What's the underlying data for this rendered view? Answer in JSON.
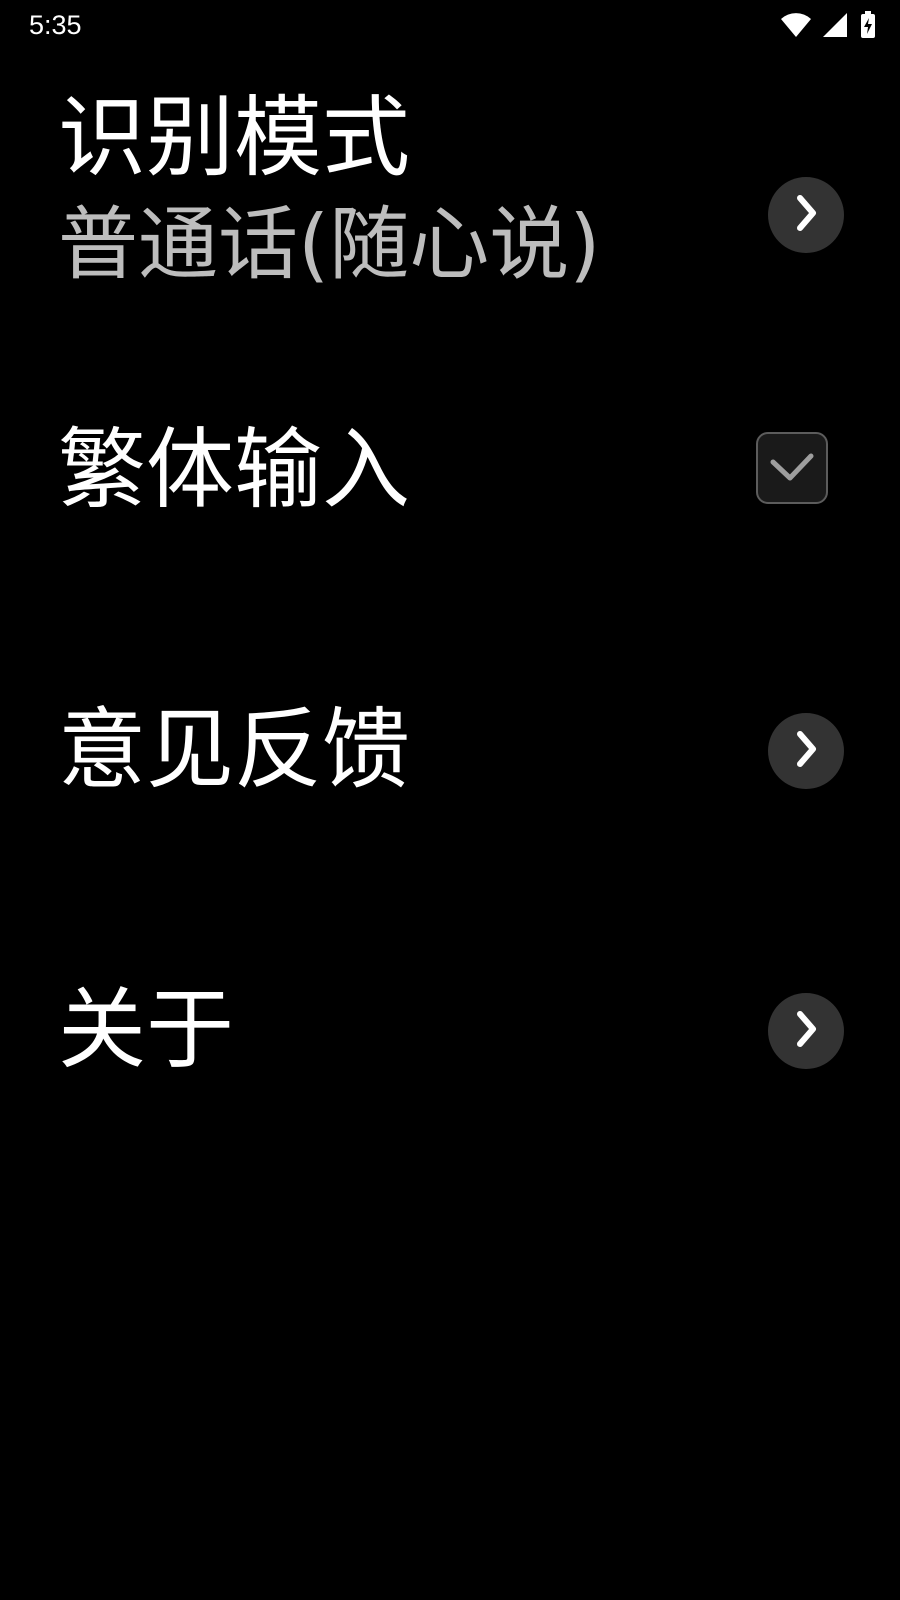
{
  "status_bar": {
    "time": "5:35",
    "icons": [
      "wifi-icon",
      "signal-icon",
      "battery-charging-icon"
    ]
  },
  "settings": {
    "recognition_mode": {
      "title": "识别模式",
      "value": "普通话(随心说)"
    },
    "traditional_input": {
      "title": "繁体输入",
      "checked": true
    },
    "feedback": {
      "title": "意见反馈"
    },
    "about": {
      "title": "关于"
    }
  },
  "colors": {
    "background": "#000000",
    "text_primary": "#ffffff",
    "text_secondary": "#bdbdbd",
    "button_bg": "#333333"
  }
}
